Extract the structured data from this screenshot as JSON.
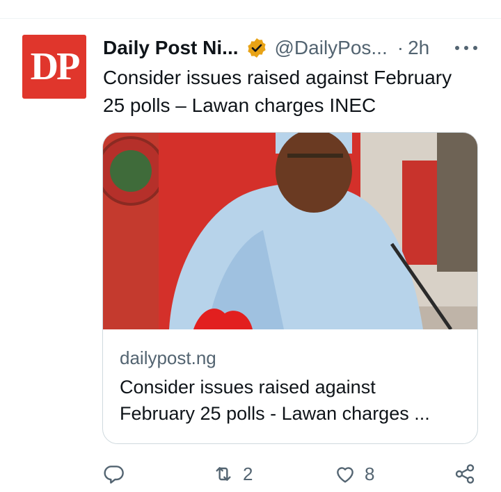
{
  "tweet": {
    "author": {
      "avatar_text": "DP",
      "display_name": "Daily Post Ni...",
      "handle": "@DailyPos...",
      "separator": "·",
      "time": "2h",
      "verified": true
    },
    "text": "Consider issues raised against February 25 polls – Lawan charges INEC",
    "card": {
      "domain": "dailypost.ng",
      "title": "Consider issues raised against February 25 polls - Lawan charges ..."
    },
    "actions": {
      "reply_count": "",
      "retweet_count": "2",
      "like_count": "8"
    }
  },
  "colors": {
    "avatar_bg": "#e0362c",
    "verified_badge": "#e8a317",
    "secondary_text": "#536471",
    "card_border": "#cfd9de"
  },
  "icons": [
    "verified-badge-icon",
    "more-icon",
    "reply-icon",
    "retweet-icon",
    "like-icon",
    "share-icon"
  ]
}
